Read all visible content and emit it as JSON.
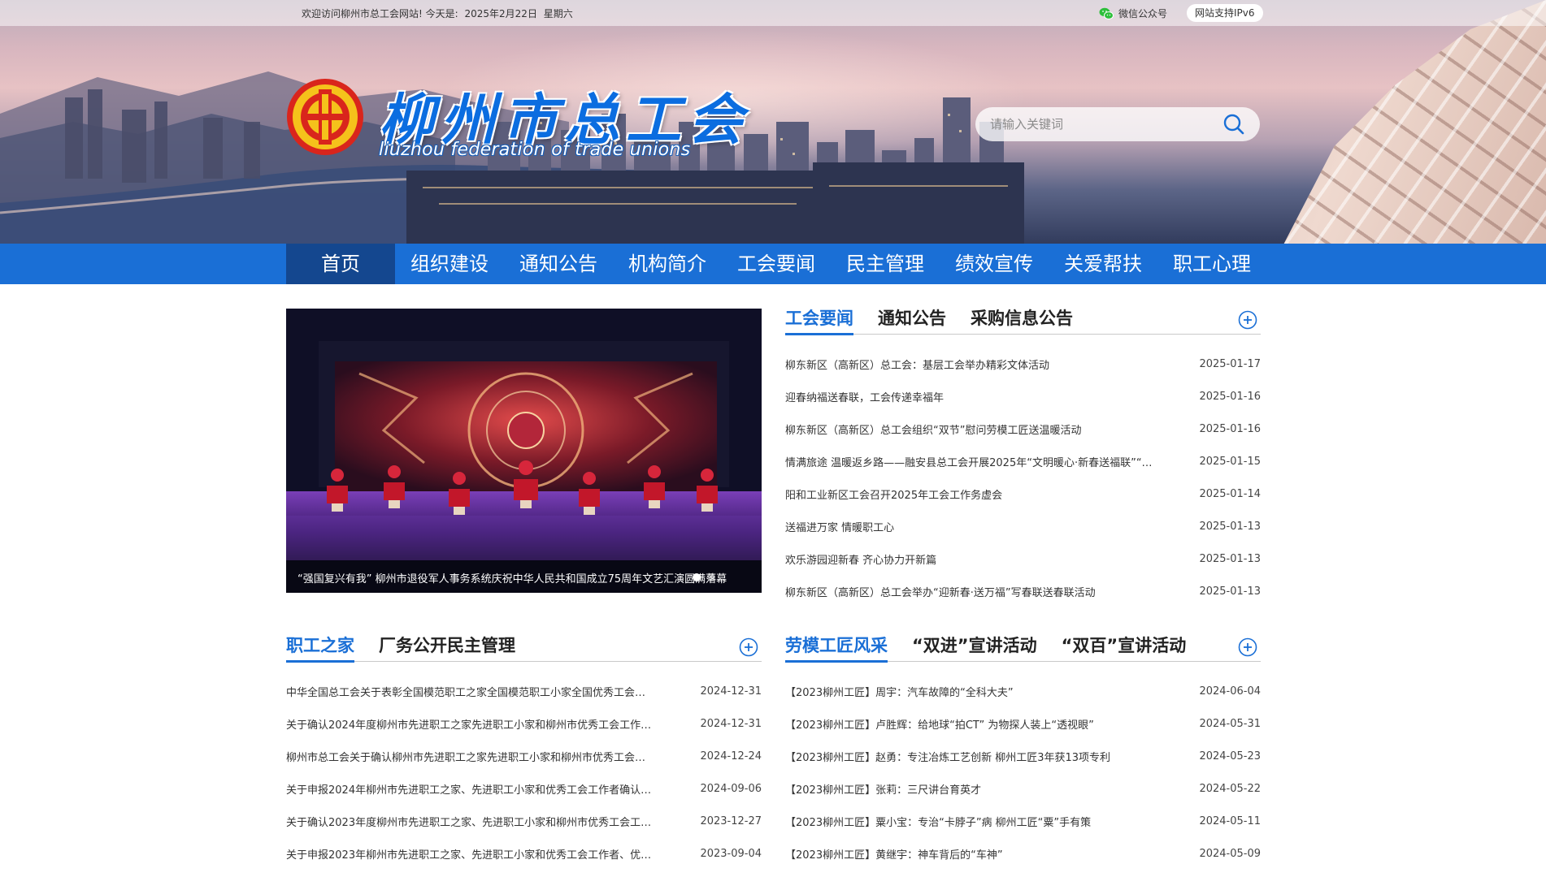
{
  "topbar": {
    "welcome": "欢迎访问柳州市总工会网站! 今天是:",
    "date": "2025年2月22日",
    "weekday": "星期六",
    "wechat_label": "微信公众号",
    "ipv6_label": "网站支持IPv6"
  },
  "header": {
    "title": "柳州市总工会",
    "subtitle": "liuzhou federation of trade unions",
    "search_placeholder": "请输入关键词"
  },
  "nav": {
    "items": [
      {
        "label": "首页"
      },
      {
        "label": "组织建设"
      },
      {
        "label": "通知公告"
      },
      {
        "label": "机构简介"
      },
      {
        "label": "工会要闻"
      },
      {
        "label": "民主管理"
      },
      {
        "label": "绩效宣传"
      },
      {
        "label": "关爱帮扶"
      },
      {
        "label": "职工心理"
      }
    ],
    "active_index": 0
  },
  "carousel": {
    "caption": "“强国复兴有我” 柳州市退役军人事务系统庆祝中华人民共和国成立75周年文艺汇演圆满落幕",
    "dot_count": 2,
    "active_dot": 0
  },
  "news_panel": {
    "tabs": [
      "工会要闻",
      "通知公告",
      "采购信息公告"
    ],
    "items": [
      {
        "title": "柳东新区（高新区）总工会：基层工会举办精彩文体活动",
        "date": "2025-01-17"
      },
      {
        "title": "迎春纳福送春联，工会传递幸福年",
        "date": "2025-01-16"
      },
      {
        "title": "柳东新区（高新区）总工会组织“双节”慰问劳模工匠送温暖活动",
        "date": "2025-01-16"
      },
      {
        "title": "情满旅途 温暖返乡路——融安县总工会开展2025年“文明暖心·新春送福联”“…",
        "date": "2025-01-15"
      },
      {
        "title": "阳和工业新区工会召开2025年工会工作务虚会",
        "date": "2025-01-14"
      },
      {
        "title": "送福进万家 情暖职工心",
        "date": "2025-01-13"
      },
      {
        "title": "欢乐游园迎新春 齐心协力开新篇",
        "date": "2025-01-13"
      },
      {
        "title": "柳东新区（高新区）总工会举办“迎新春·送万福”写春联送春联活动",
        "date": "2025-01-13"
      }
    ]
  },
  "home_panel": {
    "tabs": [
      "职工之家",
      "厂务公开民主管理"
    ],
    "items": [
      {
        "title": "中华全国总工会关于表彰全国模范职工之家全国模范职工小家全国优秀工会…",
        "date": "2024-12-31"
      },
      {
        "title": "关于确认2024年度柳州市先进职工之家先进职工小家和柳州市优秀工会工作…",
        "date": "2024-12-31"
      },
      {
        "title": "柳州市总工会关于确认柳州市先进职工之家先进职工小家和柳州市优秀工会…",
        "date": "2024-12-24"
      },
      {
        "title": "关于申报2024年柳州市先进职工之家、先进职工小家和优秀工会工作者确认…",
        "date": "2024-09-06"
      },
      {
        "title": "关于确认2023年度柳州市先进职工之家、先进职工小家和柳州市优秀工会工…",
        "date": "2023-12-27"
      },
      {
        "title": "关于申报2023年柳州市先进职工之家、先进职工小家和优秀工会工作者、优…",
        "date": "2023-09-04"
      }
    ]
  },
  "model_panel": {
    "tabs": [
      "劳模工匠风采",
      "“双进”宣讲活动",
      "“双百”宣讲活动"
    ],
    "items": [
      {
        "title": "【2023柳州工匠】周宇：汽车故障的“全科大夫”",
        "date": "2024-06-04"
      },
      {
        "title": "【2023柳州工匠】卢胜辉：给地球“拍CT” 为物探人装上“透视眼”",
        "date": "2024-05-31"
      },
      {
        "title": "【2023柳州工匠】赵勇：专注冶炼工艺创新 柳州工匠3年获13项专利",
        "date": "2024-05-23"
      },
      {
        "title": "【2023柳州工匠】张莉：三尺讲台育英才",
        "date": "2024-05-22"
      },
      {
        "title": "【2023柳州工匠】粟小宝：专治“卡脖子”病 柳州工匠“粟”手有策",
        "date": "2024-05-11"
      },
      {
        "title": "【2023柳州工匠】黄继宇：神车背后的“车神”",
        "date": "2024-05-09"
      }
    ]
  },
  "colors": {
    "brand_blue": "#1a6fd6",
    "nav_active": "#14478f",
    "logo_red": "#d9251c",
    "logo_gold": "#f5c21b"
  },
  "icons": {
    "search": "search-icon",
    "wechat": "wechat-icon",
    "more": "plus-circle-icon",
    "logo": "trade-union-emblem-icon"
  }
}
